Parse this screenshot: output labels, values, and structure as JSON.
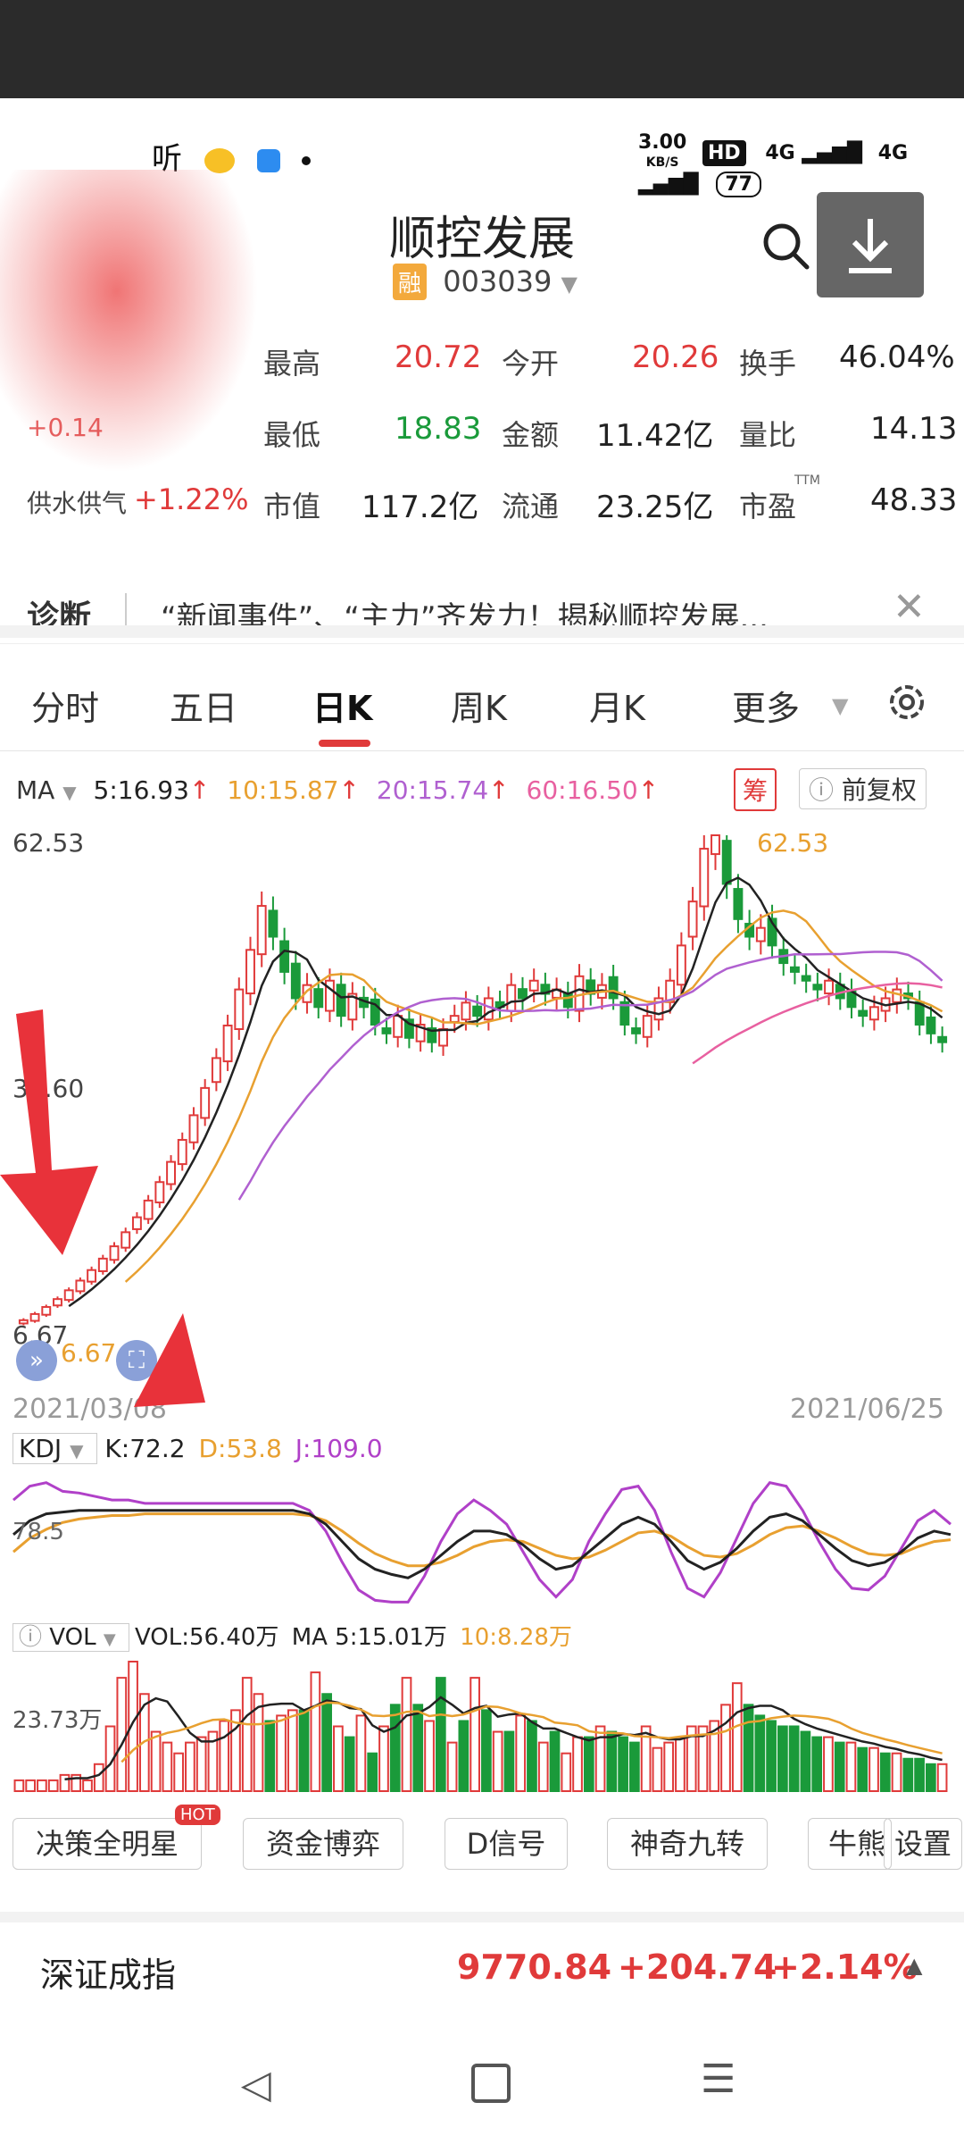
{
  "status_bar": {
    "left_text": "听",
    "net_speed": "3.00",
    "net_unit": "KB/S",
    "hd": "HD",
    "sig1": "4G",
    "sig2": "4G",
    "battery": "77"
  },
  "stock": {
    "name": "顺控发展",
    "badge": "融",
    "code": "003039"
  },
  "quote": {
    "rows": [
      [
        {
          "label": "最高",
          "value": "20.72",
          "color": "red"
        },
        {
          "label": "今开",
          "value": "20.26",
          "color": "red"
        },
        {
          "label": "换手",
          "value": "46.04%",
          "color": "black"
        }
      ],
      [
        {
          "label": "最低",
          "value": "18.83",
          "color": "green"
        },
        {
          "label": "金额",
          "value": "11.42亿",
          "color": "black"
        },
        {
          "label": "量比",
          "value": "14.13",
          "color": "black"
        }
      ],
      [
        {
          "label": "市值",
          "value": "117.2亿",
          "color": "black"
        },
        {
          "label": "流通",
          "value": "23.25亿",
          "color": "black"
        },
        {
          "label": "市盈",
          "value": "48.33",
          "color": "black"
        }
      ]
    ],
    "change_partial": "+0.14",
    "sector_name": "供水供气",
    "sector_change": "+1.22%",
    "pe_sup": "TTM"
  },
  "diagnosis": {
    "label": "诊断",
    "text": "“新闻事件”、“主力”齐发力！揭秘顺控发展..."
  },
  "tabs": [
    "分时",
    "五日",
    "日K",
    "周K",
    "月K",
    "更多"
  ],
  "active_tab": 2,
  "ma_legend": {
    "name": "MA",
    "ma5": "5:16.93",
    "ma10": "10:15.87",
    "ma20": "20:15.74",
    "ma60": "60:16.50",
    "chip": "筹",
    "adjust": "前复权"
  },
  "chart_data": [
    {
      "type": "candlestick",
      "title": "",
      "y_ticks": [
        "62.53",
        "34.60",
        "6.67"
      ],
      "x_labels": [
        "2021/03/08",
        "2021/06/25"
      ],
      "high_marker": "62.53",
      "low_marker": "6.67",
      "ylim": [
        6.67,
        62.53
      ],
      "close": [
        7.4,
        8.1,
        8.9,
        9.8,
        10.8,
        11.9,
        13.1,
        14.4,
        15.8,
        17.4,
        19.1,
        21.0,
        23.1,
        25.4,
        27.9,
        30.7,
        33.8,
        37.2,
        40.9,
        45.0,
        49.5,
        54.5,
        51.0,
        47.0,
        44.0,
        45.5,
        43.0,
        46.0,
        42.0,
        44.5,
        43.0,
        41.0,
        40.0,
        42.0,
        39.5,
        41.0,
        39.0,
        40.5,
        42.0,
        43.5,
        42.0,
        44.0,
        43.0,
        45.5,
        44.0,
        46.0,
        44.5,
        45.0,
        43.0,
        46.5,
        44.5,
        45.5,
        44.0,
        41.0,
        40.0,
        42.0,
        44.0,
        46.0,
        50.0,
        55.0,
        61.0,
        62.53,
        57.0,
        53.0,
        51.0,
        52.0,
        50.0,
        48.0,
        47.0,
        46.0,
        45.0,
        46.0,
        44.0,
        43.0,
        42.0,
        43.0,
        44.0,
        45.0,
        44.0,
        41.0,
        40.0,
        39.0
      ],
      "ma_lines": [
        "MA5",
        "MA10",
        "MA20",
        "MA60"
      ]
    },
    {
      "type": "line",
      "title": "",
      "indicator": "KDJ",
      "K": "72.2",
      "D": "53.8",
      "J": "109.0",
      "level_label": "78.5",
      "k_values": [
        70,
        78,
        82,
        83,
        84,
        84,
        84,
        84,
        84,
        84,
        84,
        84,
        84,
        84,
        84,
        84,
        84,
        84,
        82,
        76,
        66,
        56,
        50,
        47,
        45,
        50,
        58,
        66,
        72,
        72,
        70,
        64,
        56,
        50,
        52,
        60,
        68,
        76,
        80,
        76,
        66,
        55,
        50,
        54,
        62,
        72,
        80,
        82,
        78,
        70,
        62,
        55,
        52,
        54,
        60,
        68,
        72,
        70
      ],
      "d_values": [
        60,
        68,
        73,
        77,
        79,
        80,
        81,
        81,
        82,
        82,
        82,
        82,
        82,
        82,
        82,
        82,
        82,
        82,
        81,
        78,
        72,
        65,
        59,
        55,
        52,
        52,
        54,
        58,
        63,
        66,
        67,
        66,
        62,
        58,
        56,
        57,
        61,
        66,
        71,
        72,
        69,
        63,
        58,
        57,
        59,
        64,
        70,
        74,
        75,
        72,
        68,
        63,
        59,
        58,
        59,
        63,
        66,
        67
      ],
      "j_values": [
        90,
        98,
        100,
        95,
        94,
        92,
        90,
        90,
        88,
        88,
        88,
        88,
        88,
        88,
        88,
        88,
        88,
        88,
        84,
        72,
        54,
        38,
        32,
        31,
        31,
        46,
        66,
        82,
        90,
        84,
        76,
        60,
        44,
        34,
        44,
        66,
        82,
        96,
        98,
        84,
        60,
        39,
        34,
        48,
        68,
        88,
        100,
        98,
        84,
        66,
        50,
        39,
        38,
        46,
        62,
        78,
        84,
        76
      ]
    },
    {
      "type": "bar",
      "title": "",
      "indicator": "VOL",
      "vol": "VOL:56.40万",
      "ma5": "MA 5:15.01万",
      "ma10": "10:8.28万",
      "y_tick": "23.73万",
      "values": [
        2,
        2,
        2,
        2,
        3,
        3,
        2,
        5,
        12,
        21,
        24,
        18,
        11,
        9,
        7,
        9,
        10,
        11,
        13,
        15,
        21,
        18,
        13,
        14,
        15,
        15,
        22,
        18,
        12,
        10,
        14,
        7,
        12,
        16,
        21,
        16,
        13,
        21,
        9,
        13,
        21,
        15,
        11,
        11,
        14,
        13,
        9,
        11,
        7,
        10,
        10,
        12,
        11,
        10,
        9,
        12,
        8,
        9,
        10,
        12,
        12,
        13,
        16,
        20,
        16,
        14,
        13,
        12,
        12,
        11,
        10,
        10,
        9,
        9,
        8,
        8,
        7,
        7,
        6,
        6,
        5,
        5
      ],
      "colors": [
        "red",
        "red",
        "red",
        "red",
        "red",
        "red",
        "red",
        "red",
        "red",
        "red",
        "red",
        "red",
        "red",
        "red",
        "red",
        "red",
        "red",
        "red",
        "red",
        "red",
        "red",
        "red",
        "green",
        "red",
        "red",
        "green",
        "red",
        "green",
        "red",
        "green",
        "red",
        "green",
        "red",
        "green",
        "red",
        "green",
        "red",
        "green",
        "red",
        "green",
        "red",
        "green",
        "red",
        "green",
        "red",
        "green",
        "red",
        "green",
        "red",
        "red",
        "green",
        "red",
        "green",
        "green",
        "green",
        "red",
        "red",
        "red",
        "red",
        "red",
        "red",
        "red",
        "red",
        "red",
        "green",
        "green",
        "green",
        "green",
        "green",
        "green",
        "green",
        "red",
        "green",
        "red",
        "green",
        "red",
        "green",
        "red",
        "green",
        "green",
        "green",
        "red"
      ]
    }
  ],
  "indicator_buttons": {
    "b1": "决策全明星",
    "hot": "HOT",
    "b2": "资金博弈",
    "b3": "D信号",
    "b4": "神奇九转",
    "b5": "牛熊",
    "b6": "设置"
  },
  "index_bar": {
    "name": "深证成指",
    "value": "9770.84",
    "change": "+204.74",
    "pct": "+2.14%"
  },
  "colors": {
    "up": "#e03a3a",
    "down": "#1a9a3a",
    "ma5": "#222222",
    "ma10": "#e8a030",
    "ma20": "#b060d0",
    "ma60": "#e860a0"
  }
}
